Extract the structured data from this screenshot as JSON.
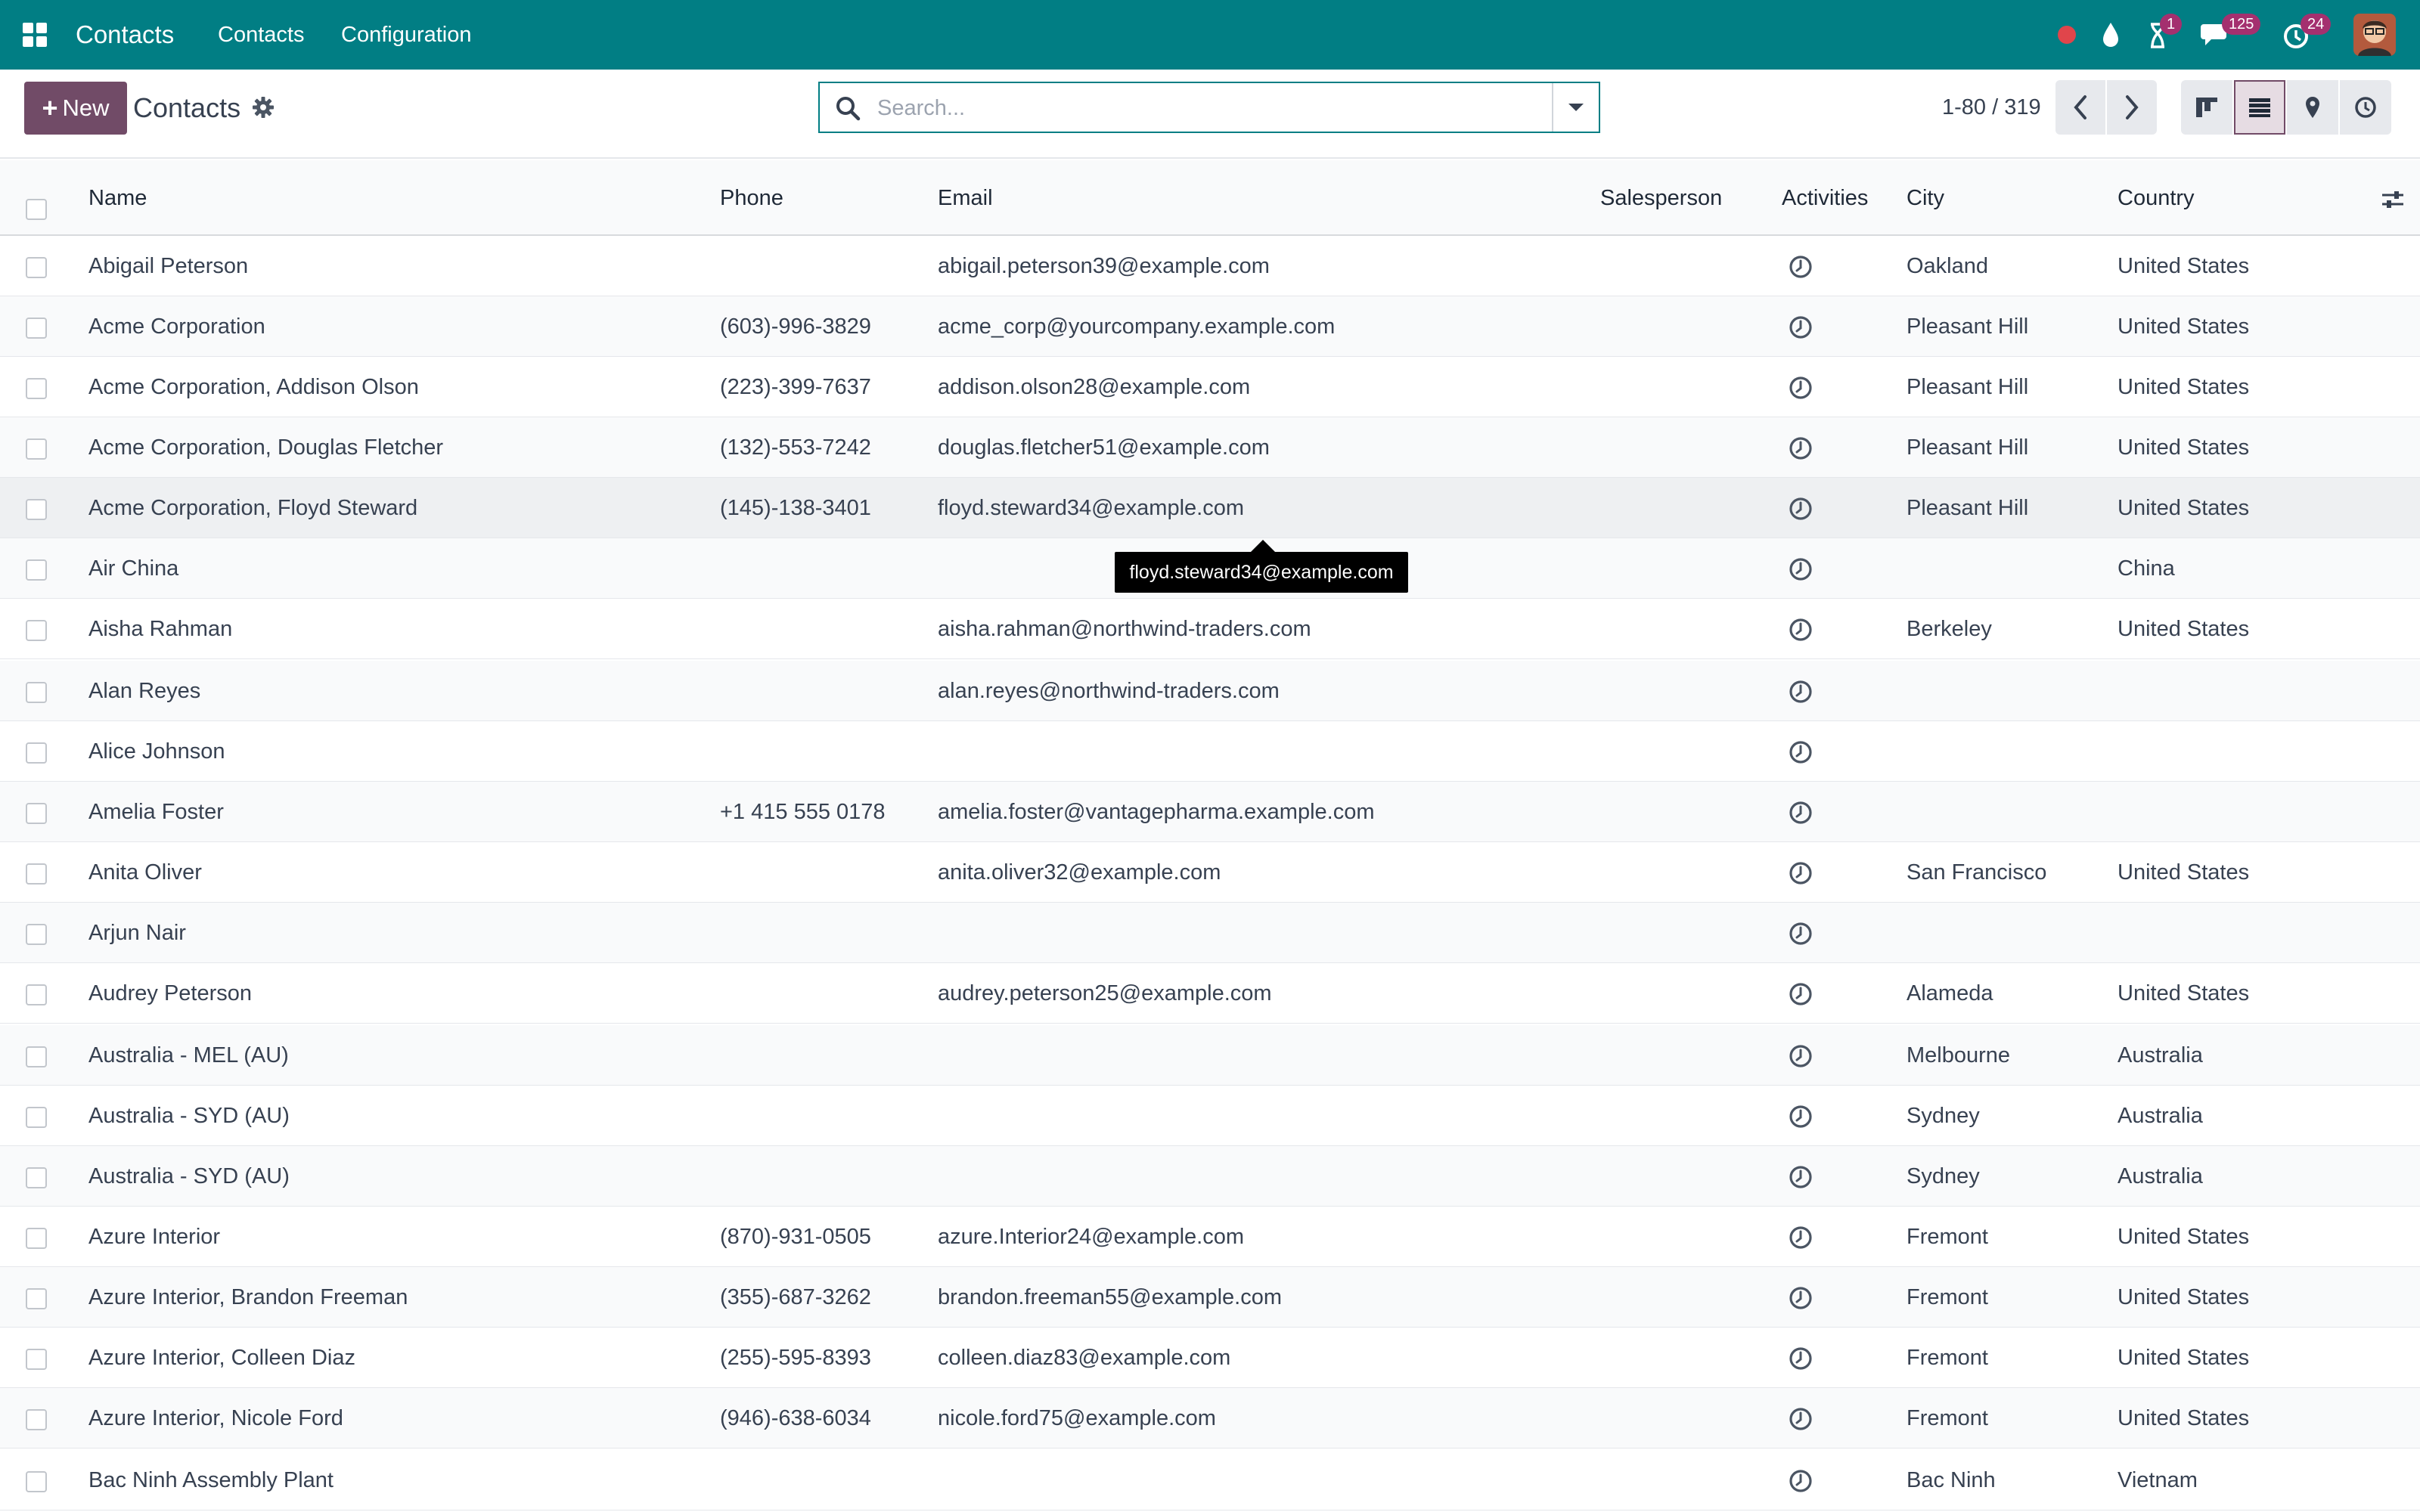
{
  "navbar": {
    "app_title": "Contacts",
    "menu": [
      "Contacts",
      "Configuration"
    ],
    "activity_badge": "1",
    "messages_badge": "125",
    "activities_badge": "24",
    "bg_color": "#017e84"
  },
  "control_panel": {
    "new_label": "New",
    "title": "Contacts",
    "search_placeholder": "Search...",
    "pager_value": "1-80 / 319",
    "accent_color": "#714b67"
  },
  "table": {
    "columns": [
      "Name",
      "Phone",
      "Email",
      "Salesperson",
      "Activities",
      "City",
      "Country"
    ],
    "rows": [
      {
        "name": "Abigail Peterson",
        "phone": "",
        "email": "abigail.peterson39@example.com",
        "city": "Oakland",
        "country": "United States"
      },
      {
        "name": "Acme Corporation",
        "phone": "(603)-996-3829",
        "email": "acme_corp@yourcompany.example.com",
        "city": "Pleasant Hill",
        "country": "United States"
      },
      {
        "name": "Acme Corporation, Addison Olson",
        "phone": "(223)-399-7637",
        "email": "addison.olson28@example.com",
        "city": "Pleasant Hill",
        "country": "United States"
      },
      {
        "name": "Acme Corporation, Douglas Fletcher",
        "phone": "(132)-553-7242",
        "email": "douglas.fletcher51@example.com",
        "city": "Pleasant Hill",
        "country": "United States"
      },
      {
        "name": "Acme Corporation, Floyd Steward",
        "phone": "(145)-138-3401",
        "email": "floyd.steward34@example.com",
        "city": "Pleasant Hill",
        "country": "United States"
      },
      {
        "name": "Air China",
        "phone": "",
        "email": "",
        "city": "",
        "country": "China"
      },
      {
        "name": "Aisha Rahman",
        "phone": "",
        "email": "aisha.rahman@northwind-traders.com",
        "city": "Berkeley",
        "country": "United States"
      },
      {
        "name": "Alan Reyes",
        "phone": "",
        "email": "alan.reyes@northwind-traders.com",
        "city": "",
        "country": ""
      },
      {
        "name": "Alice Johnson",
        "phone": "",
        "email": "",
        "city": "",
        "country": ""
      },
      {
        "name": "Amelia Foster",
        "phone": "+1 415 555 0178",
        "email": "amelia.foster@vantagepharma.example.com",
        "city": "",
        "country": ""
      },
      {
        "name": "Anita Oliver",
        "phone": "",
        "email": "anita.oliver32@example.com",
        "city": "San Francisco",
        "country": "United States"
      },
      {
        "name": "Arjun Nair",
        "phone": "",
        "email": "",
        "city": "",
        "country": ""
      },
      {
        "name": "Audrey Peterson",
        "phone": "",
        "email": "audrey.peterson25@example.com",
        "city": "Alameda",
        "country": "United States"
      },
      {
        "name": "Australia - MEL (AU)",
        "phone": "",
        "email": "",
        "city": "Melbourne",
        "country": "Australia"
      },
      {
        "name": "Australia - SYD (AU)",
        "phone": "",
        "email": "",
        "city": "Sydney",
        "country": "Australia"
      },
      {
        "name": "Australia - SYD (AU)",
        "phone": "",
        "email": "",
        "city": "Sydney",
        "country": "Australia"
      },
      {
        "name": "Azure Interior",
        "phone": "(870)-931-0505",
        "email": "azure.Interior24@example.com",
        "city": "Fremont",
        "country": "United States"
      },
      {
        "name": "Azure Interior, Brandon Freeman",
        "phone": "(355)-687-3262",
        "email": "brandon.freeman55@example.com",
        "city": "Fremont",
        "country": "United States"
      },
      {
        "name": "Azure Interior, Colleen Diaz",
        "phone": "(255)-595-8393",
        "email": "colleen.diaz83@example.com",
        "city": "Fremont",
        "country": "United States"
      },
      {
        "name": "Azure Interior, Nicole Ford",
        "phone": "(946)-638-6034",
        "email": "nicole.ford75@example.com",
        "city": "Fremont",
        "country": "United States"
      },
      {
        "name": "Bac Ninh Assembly Plant",
        "phone": "",
        "email": "",
        "city": "Bac Ninh",
        "country": "Vietnam"
      }
    ]
  },
  "tooltip": {
    "text": "floyd.steward34@example.com"
  }
}
